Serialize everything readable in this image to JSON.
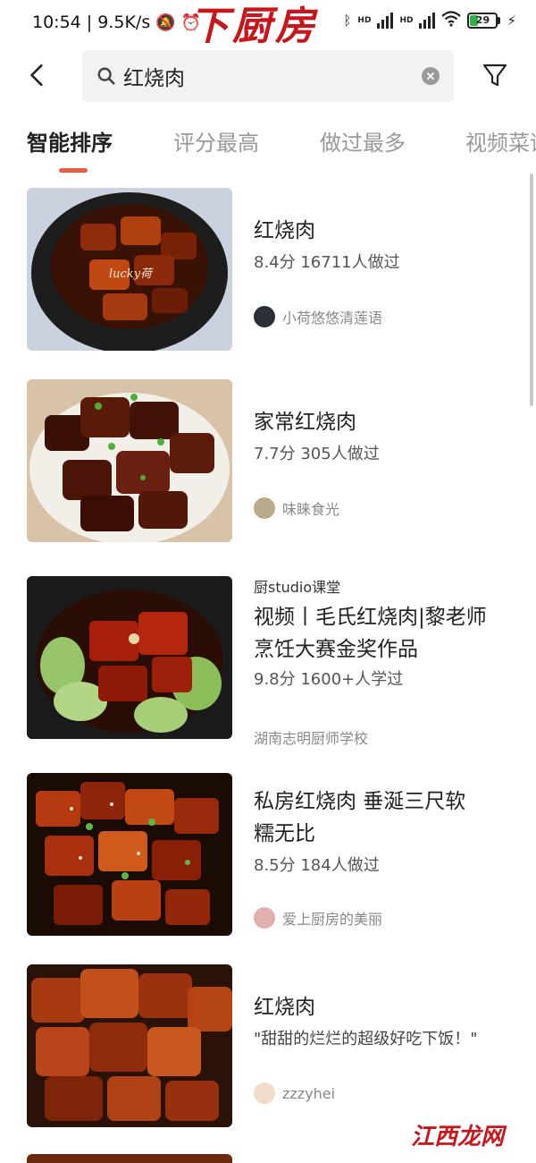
{
  "status_bar": {
    "time_speed": "10:54 | 9.5K/s",
    "brand": "下厨房",
    "battery": "29",
    "hd1": "HD",
    "hd2": "HD"
  },
  "header": {
    "search_value": "红烧肉",
    "icons": {
      "back": "back-arrow-icon",
      "search": "search-icon",
      "clear": "clear-icon",
      "filter": "filter-icon"
    }
  },
  "tabs": [
    {
      "label": "智能排序",
      "active": true
    },
    {
      "label": "评分最高",
      "active": false
    },
    {
      "label": "做过最多",
      "active": false
    },
    {
      "label": "视频菜谱",
      "active": false
    }
  ],
  "recipes": [
    {
      "pre_label": "",
      "title_line1": "红烧肉",
      "title_line2": "",
      "meta": "8.4分 16711人做过",
      "quote": "",
      "author": "小荷悠悠清莲语",
      "image_text": "lucky荷"
    },
    {
      "pre_label": "",
      "title_line1": "家常红烧肉",
      "title_line2": "",
      "meta": "7.7分 305人做过",
      "quote": "",
      "author": "味睐食光",
      "image_text": ""
    },
    {
      "pre_label": "厨studio课堂",
      "title_line1": "视频丨毛氏红烧肉|黎老师",
      "title_line2": "烹饪大赛金奖作品",
      "meta": "9.8分 1600+人学过",
      "quote": "",
      "author": "湖南志明厨师学校",
      "image_text": ""
    },
    {
      "pre_label": "",
      "title_line1": "私房红烧肉 垂涎三尺软",
      "title_line2": "糯无比",
      "meta": "8.5分 184人做过",
      "quote": "",
      "author": "爱上厨房的美丽",
      "image_text": ""
    },
    {
      "pre_label": "",
      "title_line1": "红烧肉",
      "title_line2": "",
      "meta": "",
      "quote": "\"甜甜的烂烂的超级好吃下饭！\"",
      "author": "zzzyhei",
      "image_text": ""
    }
  ],
  "watermark": "江西龙网",
  "colors": {
    "accent": "#e85d3d",
    "brand": "#c8171c"
  }
}
